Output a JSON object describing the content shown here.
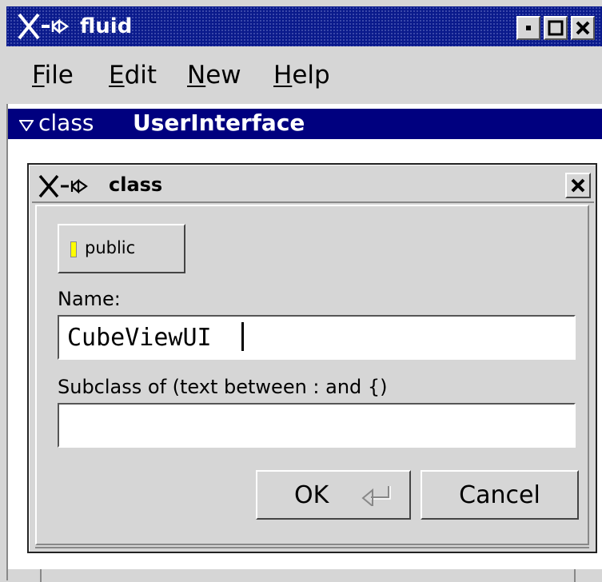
{
  "window": {
    "title": "fluid",
    "controls": [
      "minimize-icon",
      "maximize-icon",
      "close-icon"
    ]
  },
  "menubar": {
    "items": [
      {
        "label": "File",
        "mnemonic": "F",
        "rest": "ile"
      },
      {
        "label": "Edit",
        "mnemonic": "E",
        "rest": "dit"
      },
      {
        "label": "New",
        "mnemonic": "N",
        "rest": "ew"
      },
      {
        "label": "Help",
        "mnemonic": "H",
        "rest": "elp"
      }
    ]
  },
  "tree": {
    "selected_keyword": "class",
    "selected_name": "UserInterface",
    "expanded": true,
    "highlight_color": "#00007f"
  },
  "dialog": {
    "title": "class",
    "public_label": "public",
    "public_led_color": "#ffff00",
    "name_label": "Name:",
    "name_value": "CubeViewUI",
    "subclass_label": "Subclass of (text between : and {)",
    "subclass_value": "",
    "ok_label": "OK",
    "ok_icon": "return-icon",
    "cancel_label": "Cancel"
  }
}
